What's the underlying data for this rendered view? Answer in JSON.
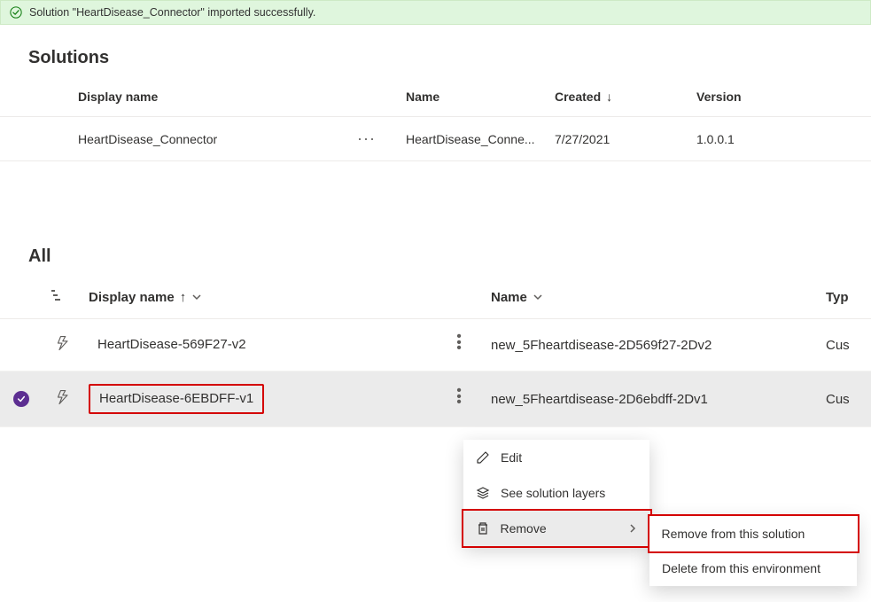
{
  "banner": {
    "message": "Solution \"HeartDisease_Connector\" imported successfully."
  },
  "sections": {
    "solutions": "Solutions",
    "all": "All"
  },
  "solutions_table": {
    "headers": {
      "display": "Display name",
      "name": "Name",
      "created": "Created",
      "version": "Version"
    },
    "rows": [
      {
        "display": "HeartDisease_Connector",
        "name": "HeartDisease_Conne...",
        "created": "7/27/2021",
        "version": "1.0.0.1"
      }
    ]
  },
  "all_table": {
    "headers": {
      "display": "Display name",
      "name": "Name",
      "type": "Typ"
    },
    "rows": [
      {
        "display": "HeartDisease-569F27-v2",
        "system_name": "new_5Fheartdisease-2D569f27-2Dv2",
        "type": "Cus",
        "selected": false
      },
      {
        "display": "HeartDisease-6EBDFF-v1",
        "system_name": "new_5Fheartdisease-2D6ebdff-2Dv1",
        "type": "Cus",
        "selected": true
      }
    ]
  },
  "context_menu": {
    "edit": "Edit",
    "layers": "See solution layers",
    "remove": "Remove"
  },
  "submenu": {
    "remove_solution": "Remove from this solution",
    "delete_env": "Delete from this environment"
  }
}
